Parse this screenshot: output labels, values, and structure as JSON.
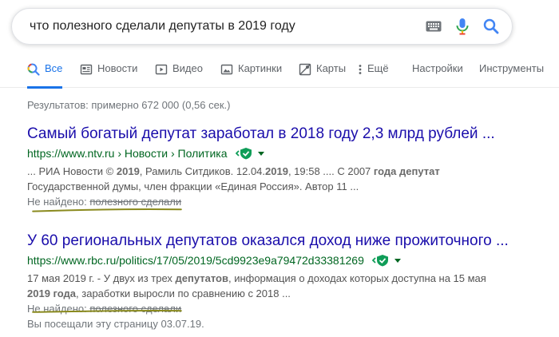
{
  "search": {
    "query": "что полезного сделали депутаты в 2019 году",
    "keyboard_icon": "keyboard-icon",
    "mic_icon": "microphone-icon",
    "search_icon": "search-icon"
  },
  "tabs": [
    {
      "label": "Все",
      "icon": "search-icon",
      "active": true
    },
    {
      "label": "Новости",
      "icon": "newspaper-icon"
    },
    {
      "label": "Видео",
      "icon": "play-icon"
    },
    {
      "label": "Картинки",
      "icon": "image-icon"
    },
    {
      "label": "Карты",
      "icon": "map-icon"
    },
    {
      "label": "Ещё",
      "icon": "more-vertical-icon"
    },
    {
      "label": "Настройки"
    },
    {
      "label": "Инструменты"
    }
  ],
  "stats": "Результатов: примерно 672 000 (0,56 сек.)",
  "results": [
    {
      "title": "Самый богатый депутат заработал в 2018 году 2,3 млрд рублей ...",
      "url": "https://www.ntv.ru › Новости › Политика",
      "snippet_line1": {
        "p1": "... РИА Новости © ",
        "b1": "2019",
        "p2": ", Рамиль Ситдиков. 12.04.",
        "b2": "2019",
        "p3": ", 19:58 .... С 2007 ",
        "b3": "года депутат"
      },
      "snippet_line2": "Государственной думы, член фракции «Единая Россия». Автор 11 ...",
      "missing_label": "Не найдено:",
      "missing_terms": "полезного сделали"
    },
    {
      "title": "У 60 региональных депутатов оказался доход ниже прожиточного ...",
      "url": "https://www.rbc.ru/politics/17/05/2019/5cd9923e9a79472d33381269",
      "snippet_line1": {
        "p1": "17 мая 2019 г. - У двух из трех ",
        "b1": "депутатов",
        "p2": ", информация о доходах которых доступна на 15 мая"
      },
      "snippet_line2": {
        "b1": "2019 года",
        "p1": ", заработки выросли по сравнению с 2018 ..."
      },
      "missing_label": "Не найдено:",
      "missing_terms": "полезного сделали",
      "visited": "Вы посещали эту страницу 03.07.19."
    }
  ],
  "colors": {
    "link": "#1a0dab",
    "url": "#006621",
    "active_tab": "#1a73e8",
    "verified_badge": "#0f9d58",
    "annotation_underline": "#8a8a1e"
  }
}
